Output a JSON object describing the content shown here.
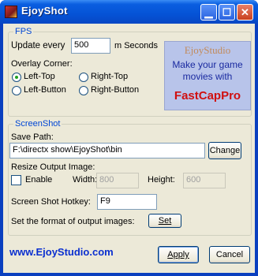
{
  "window": {
    "title": "EjoyShot"
  },
  "fps": {
    "legend": "FPS",
    "update_label": "Update every",
    "update_value": "500",
    "update_unit": "m Seconds",
    "overlay_label": "Overlay Corner:",
    "corners": [
      {
        "label": "Left-Top",
        "selected": true
      },
      {
        "label": "Right-Top",
        "selected": false
      },
      {
        "label": "Left-Button",
        "selected": false
      },
      {
        "label": "Right-Button",
        "selected": false
      }
    ]
  },
  "banner": {
    "line1": "EjoyStudio",
    "line2": "Make your game movies with",
    "line3": "FastCapPro"
  },
  "screenshot": {
    "legend": "ScreenShot",
    "save_path_label": "Save Path:",
    "save_path_value": "F:\\directx show\\EjoyShot\\bin",
    "change_label": "Change",
    "resize_label": "Resize Output Image:",
    "enable_label": "Enable",
    "enable_checked": false,
    "width_label": "Width:",
    "width_value": "800",
    "height_label": "Height:",
    "height_value": "600",
    "hotkey_label": "Screen Shot Hotkey:",
    "hotkey_value": "F9",
    "format_label": "Set the format of output images:",
    "set_label": "Set"
  },
  "footer": {
    "link": "www.EjoyStudio.com",
    "apply_label": "Apply",
    "cancel_label": "Cancel"
  }
}
